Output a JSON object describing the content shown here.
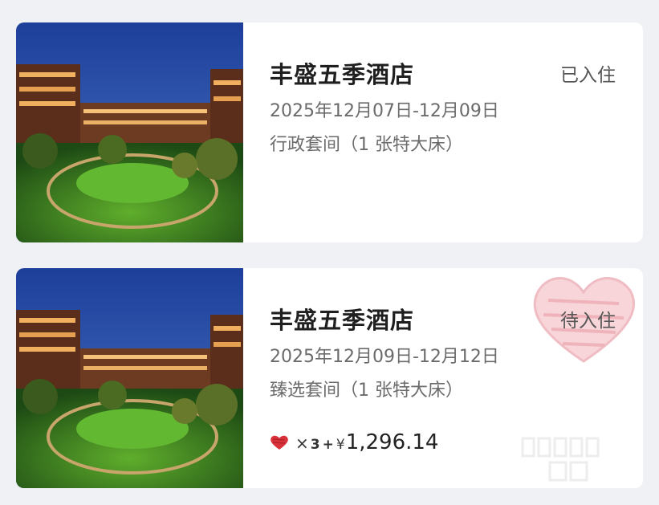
{
  "bookings": [
    {
      "hotel_name": "丰盛五季酒店",
      "dates": "2025年12月07日-12月09日",
      "room": "行政套间（1 张特大床）",
      "status": "已入住",
      "thumbnail_icon": "hotel-courtyard-photo"
    },
    {
      "hotel_name": "丰盛五季酒店",
      "dates": "2025年12月09日-12月12日",
      "room": "臻选套间（1 张特大床）",
      "status": "待入住",
      "thumbnail_icon": "hotel-courtyard-photo",
      "price": {
        "heart_icon": "red-heart-icon",
        "multiplier": "×",
        "count": "3",
        "plus": "+",
        "currency": "¥",
        "amount": "1,296.14"
      }
    }
  ],
  "colors": {
    "background": "#f0f1f5",
    "card": "#ffffff",
    "title": "#1f1f1f",
    "secondary_text": "#6b6b6b",
    "heart_red": "#d9313a",
    "watermark_pink": "#f3c7cc"
  }
}
